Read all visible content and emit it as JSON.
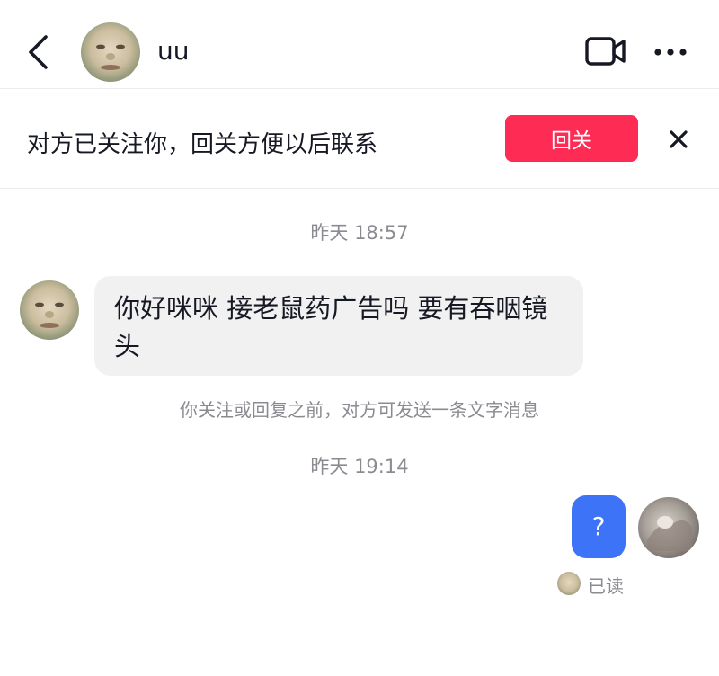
{
  "header": {
    "contact_name": "uu",
    "icons": {
      "back": "back-chevron-icon",
      "video": "video-camera-icon",
      "more": "more-dots-icon"
    }
  },
  "follow_banner": {
    "text": "对方已关注你，回关方便以后联系",
    "button_label": "回关",
    "accent_color": "#fe2c55",
    "close_icon": "close-icon"
  },
  "chat": {
    "time_1": "昨天 18:57",
    "incoming_message": "你好咪咪 接老鼠药广告吗 要有吞咽镜头",
    "notice": "你关注或回复之前，对方可发送一条文字消息",
    "time_2": "昨天 19:14",
    "outgoing_message": "?",
    "outgoing_bubble_color": "#3d74f7",
    "read_status": "已读"
  }
}
